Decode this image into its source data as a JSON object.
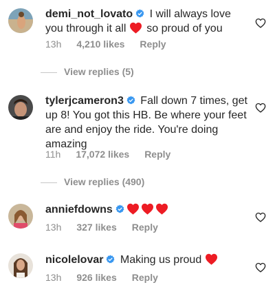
{
  "comments": [
    {
      "username": "demi_not_lovato",
      "text_before": " I will always love you through it all ",
      "text_after": " so proud of you",
      "time": "13h",
      "likes": "4,210 likes",
      "reply": "Reply",
      "view_replies": "View replies (5)"
    },
    {
      "username": "tylerjcameron3",
      "text_before": " Fall down 7 times, get up 8! You got this HB. Be where your feet are and enjoy the ride. You're doing amazing",
      "time": "11h",
      "likes": "17,072 likes",
      "reply": "Reply",
      "view_replies": "View replies (490)"
    },
    {
      "username": "anniefdowns",
      "time": "13h",
      "likes": "327 likes",
      "reply": "Reply"
    },
    {
      "username": "nicolelovar",
      "text_before": " Making us proud ",
      "time": "13h",
      "likes": "926 likes",
      "reply": "Reply"
    }
  ],
  "colors": {
    "verified": "#3897f0",
    "heart": "#ed1c24",
    "muted": "#8e8e8e"
  }
}
